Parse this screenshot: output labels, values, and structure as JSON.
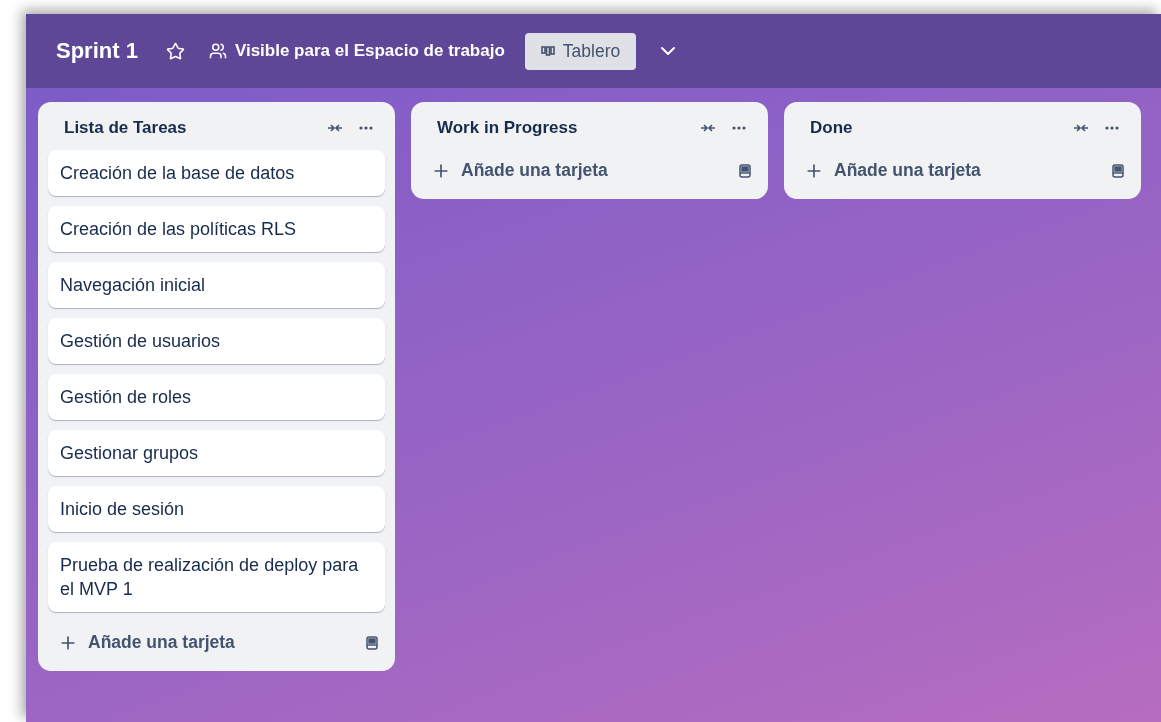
{
  "board": {
    "title": "Sprint 1",
    "starred": false,
    "visibility": "Visible para el Espacio de trabajo",
    "view": "Tablero"
  },
  "lists": [
    {
      "title": "Lista de Tareas",
      "cards": [
        "Creación de la base de datos",
        "Creación de las políticas RLS",
        "Navegación inicial",
        "Gestión de usuarios",
        "Gestión de roles",
        "Gestionar grupos",
        "Inicio de sesión",
        "Prueba de realización de deploy para el MVP 1"
      ],
      "add_label": "Añade una tarjeta"
    },
    {
      "title": "Work in Progress",
      "add_label": "Añade una tarjeta"
    },
    {
      "title": "Done",
      "add_label": "Añade una tarjeta"
    }
  ]
}
